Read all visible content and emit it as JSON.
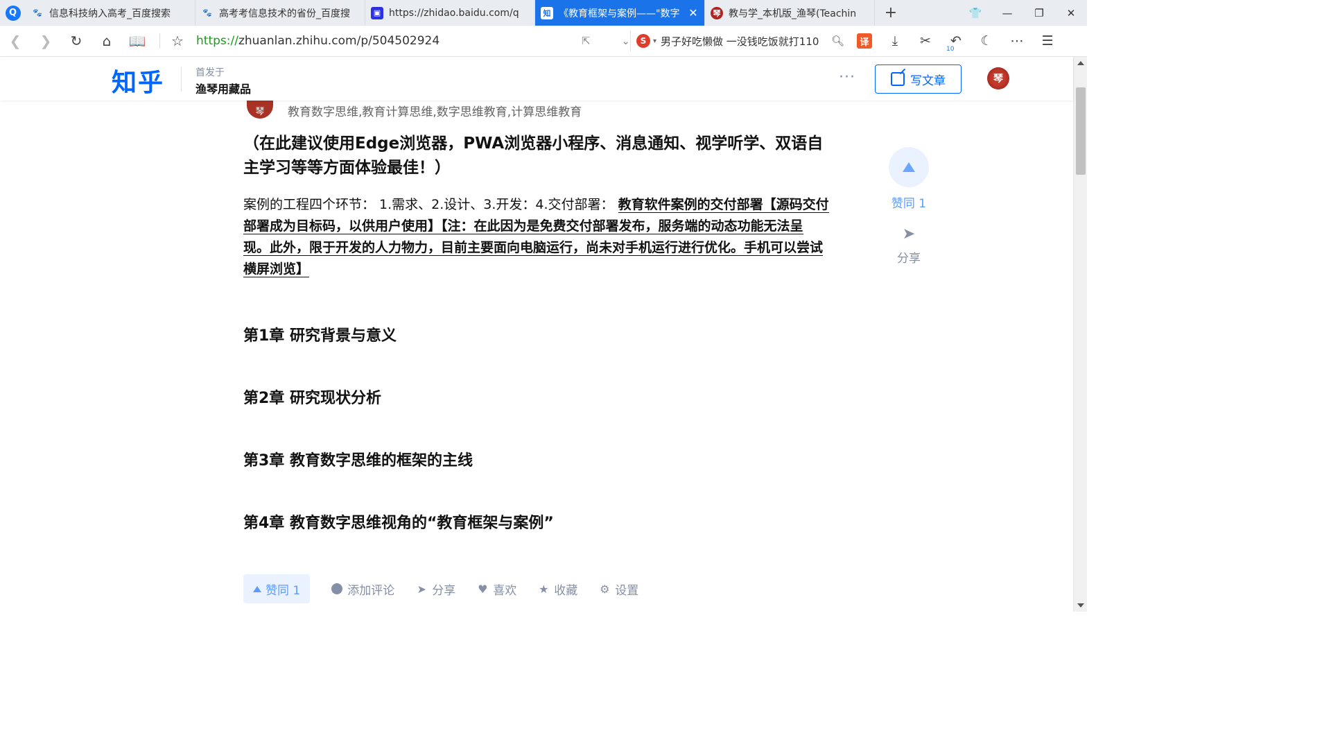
{
  "browser": {
    "logo_glyph": "Q",
    "tabs": [
      {
        "title": "信息科技纳入高考_百度搜索",
        "favicon": "baidu-paw-icon",
        "active": false
      },
      {
        "title": "高考考信息技术的省份_百度搜",
        "favicon": "baidu-paw-icon",
        "active": false
      },
      {
        "title": "https://zhidao.baidu.com/q",
        "favicon": "baidu-zhidao-icon",
        "active": false
      },
      {
        "title": "《教育框架与案例——\"数字",
        "favicon": "zhihu-icon",
        "active": true
      },
      {
        "title": "教与学_本机版_渔琴(Teachin",
        "favicon": "seal-icon",
        "active": false
      }
    ],
    "favicon_glyphs": {
      "baidu": "🐾",
      "zhihu": "知",
      "seal": "琴",
      "url": "▣"
    },
    "new_tab_label": "+",
    "address": {
      "scheme": "https://",
      "rest": "zhuanlan.zhihu.com/p/504502924"
    },
    "search": {
      "engine_glyph": "S",
      "query": "男子好吃懒做 一没钱吃饭就打110"
    },
    "translate_glyph": "译",
    "undo_badge": "10",
    "accent_color": "#1a73e8"
  },
  "zhihu_header": {
    "logo": "知乎",
    "first_published_label": "首发于",
    "column_name": "渔琴用藏品",
    "more_label": "···",
    "write_button": "写文章",
    "avatar_glyph": "琴"
  },
  "article": {
    "author_avatar_glyph": "琴",
    "author_tags": "教育数字思维,教育计算思维,数字思维教育,计算思维教育",
    "lead": "（在此建议使用Edge浏览器，PWA浏览器小程序、消息通知、视学听学、双语自主学习等等方面体验最佳！）",
    "para_prefix": "案例的工程四个环节： 1.需求、2.设计、3.开发：4.交付部署： ",
    "para_link": "教育软件案例的交付部署【源码交付部署成为目标码，以供用户使用】【注：在此因为是免费交付部署发布，服务端的动态功能无法呈现。此外，限于开发的人力物力，目前主要面向电脑运行，尚未对手机运行进行优化。手机可以尝试横屏浏览】",
    "chapters": [
      "第1章 研究背景与意义",
      "第2章 研究现状分析",
      "第3章 教育数字思维的框架的主线",
      "第4章 教育数字思维视角的“教育框架与案例”"
    ]
  },
  "side_actions": {
    "vote_label": "赞同 1",
    "share_label": "分享"
  },
  "action_bar": {
    "vote": "赞同 1",
    "comment": "添加评论",
    "share": "分享",
    "like": "喜欢",
    "collect": "收藏",
    "settings": "设置"
  },
  "colors": {
    "zhihu_blue": "#0066ff",
    "vote_bg": "#eaf2ff",
    "muted": "#8590a6"
  }
}
